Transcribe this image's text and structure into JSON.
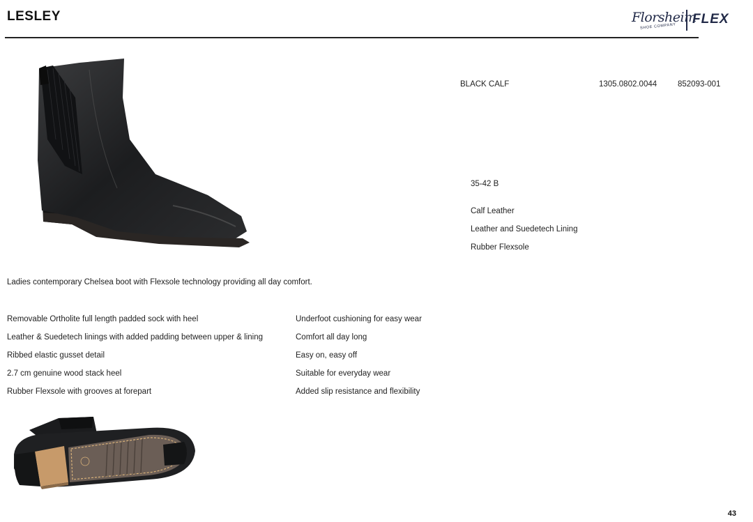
{
  "header": {
    "title": "LESLEY",
    "brand_script": "Florsheim",
    "brand_sub": "SHOE COMPANY",
    "brand_flex": "FLEX"
  },
  "product_line": {
    "color": "BLACK CALF",
    "code_1": "1305.0802.0044",
    "code_2": "852093-001"
  },
  "specs": {
    "sizes": "35-42 B",
    "upper": "Calf Leather",
    "lining": "Leather and Suedetech Lining",
    "sole": "Rubber Flexsole"
  },
  "description": "Ladies contemporary Chelsea boot with Flexsole technology providing all day comfort.",
  "features": [
    {
      "feature": "Removable Ortholite full length padded sock with heel",
      "benefit": "Underfoot cushioning for easy wear"
    },
    {
      "feature": "Leather & Suedetech linings with added padding between upper & lining",
      "benefit": "Comfort all day long"
    },
    {
      "feature": "Ribbed elastic gusset detail",
      "benefit": "Easy on, easy off"
    },
    {
      "feature": "2.7 cm genuine wood stack heel",
      "benefit": "Suitable for everyday wear"
    },
    {
      "feature": "Rubber Flexsole with grooves at forepart",
      "benefit": "Added slip resistance and flexibility"
    }
  ],
  "page_number": "43",
  "colors": {
    "brand_navy": "#222a48",
    "leather_black": "#1e1f20",
    "wood_heel": "#c79a6a"
  }
}
